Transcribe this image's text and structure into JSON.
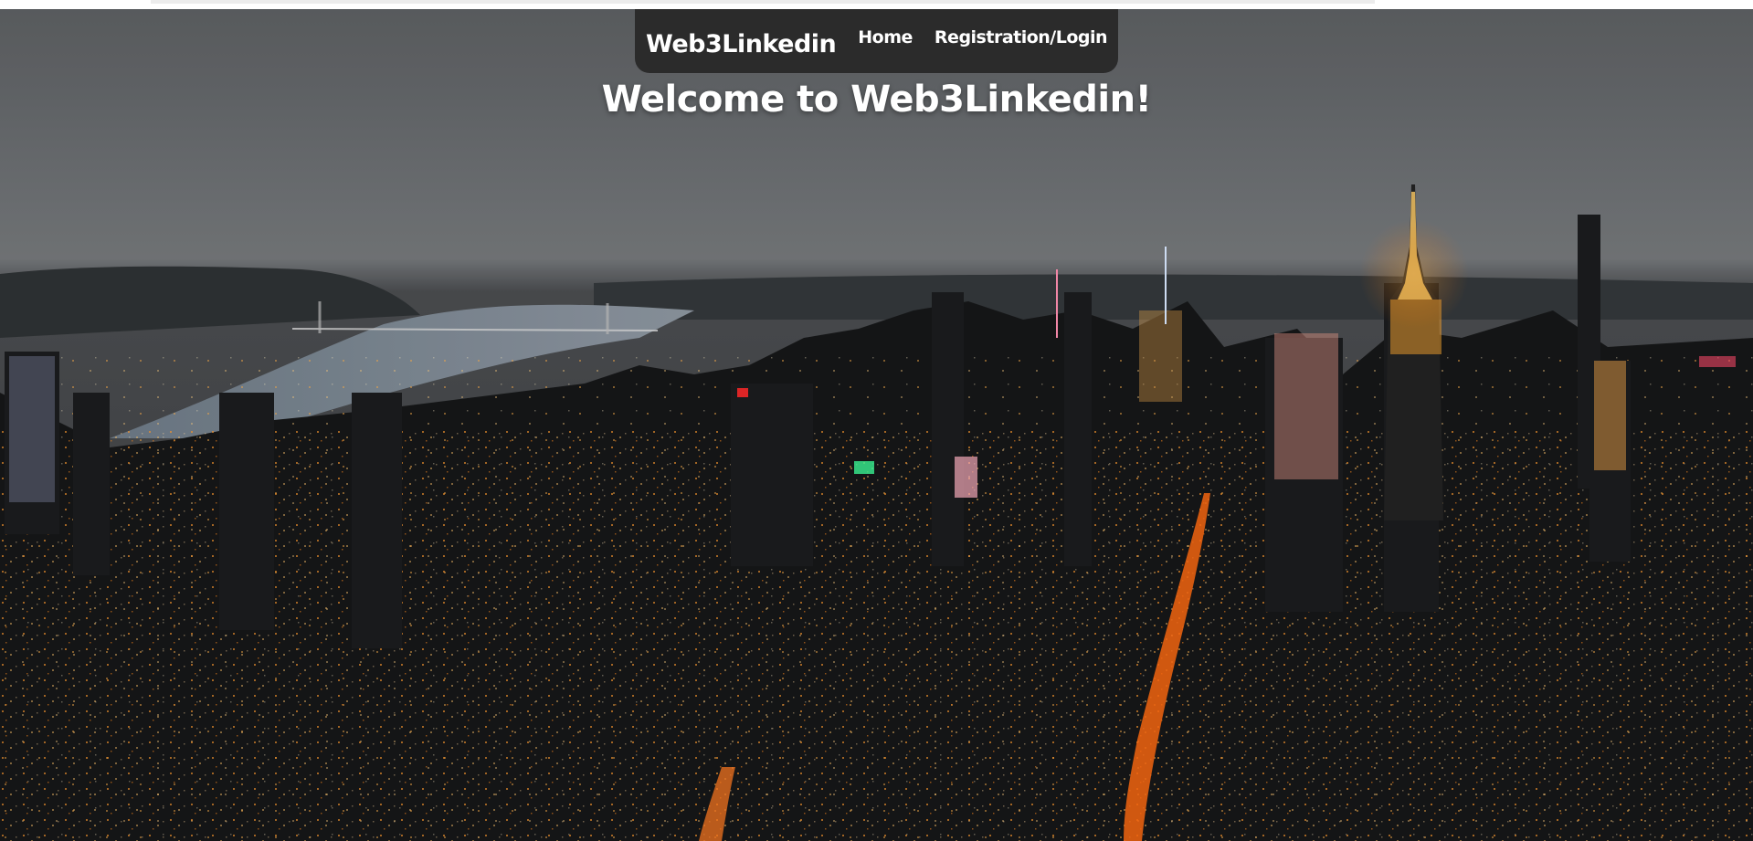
{
  "nav": {
    "brand": "Web3Linkedin",
    "links": [
      {
        "label": "Home"
      },
      {
        "label": "Registration/Login"
      }
    ]
  },
  "hero": {
    "heading": "Welcome to Web3Linkedin!",
    "background": "night-city-skyline-photo"
  },
  "colors": {
    "nav_bg": "#2b2b2b",
    "text": "#ffffff",
    "city_lights": "#ff9a2e"
  }
}
